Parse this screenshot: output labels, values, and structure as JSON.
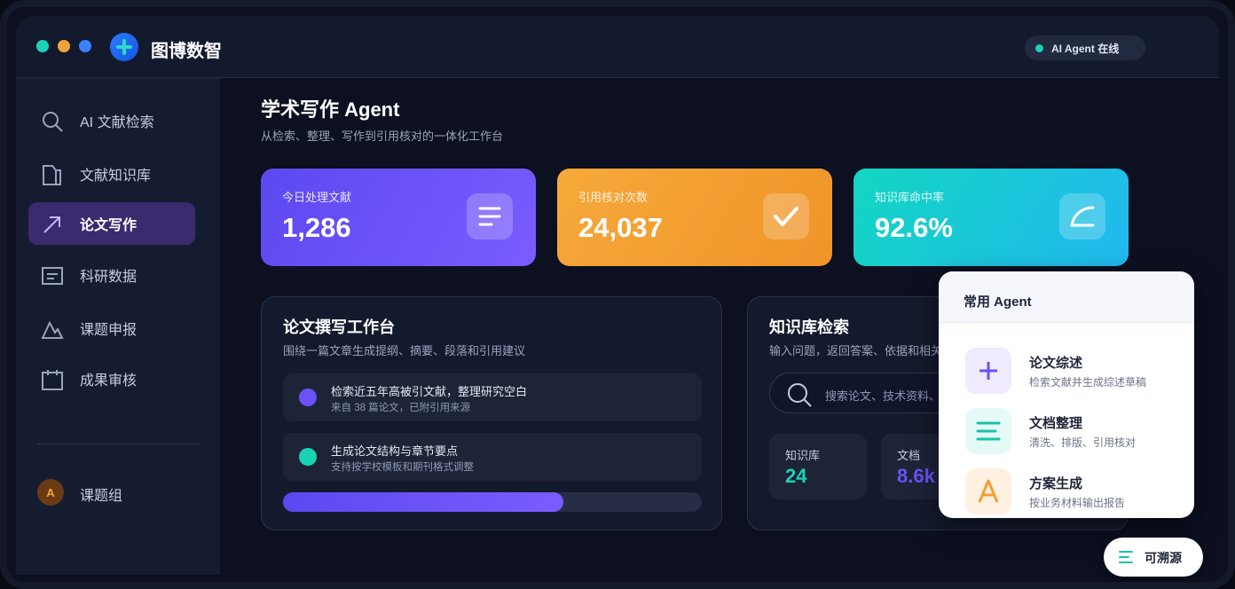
{
  "window": {
    "brand": "图博数智",
    "status": "AI Agent 在线"
  },
  "sidebar": {
    "items": [
      {
        "label": "AI 文献检索",
        "icon": "search-icon"
      },
      {
        "label": "文献知识库",
        "icon": "book-icon"
      },
      {
        "label": "论文写作",
        "icon": "arrow-up-right-icon",
        "active": true
      },
      {
        "label": "科研数据",
        "icon": "data-list-icon"
      },
      {
        "label": "课题申报",
        "icon": "mountain-icon"
      },
      {
        "label": "成果审核",
        "icon": "calendar-icon"
      }
    ],
    "user": {
      "avatar_letter": "A",
      "label": "课题组"
    }
  },
  "main": {
    "title": "学术写作 Agent",
    "subtitle": "从检索、整理、写作到引用核对的一体化工作台"
  },
  "stats": [
    {
      "label": "今日处理文献",
      "value": "1,286",
      "icon": "list-icon",
      "color": "#6a52f6"
    },
    {
      "label": "引用核对次数",
      "value": "24,037",
      "icon": "check-icon",
      "color": "#f39f33"
    },
    {
      "label": "知识库命中率",
      "value": "92.6%",
      "icon": "gauge-icon",
      "color": "#18c9d8"
    }
  ],
  "writing_panel": {
    "title": "论文撰写工作台",
    "subtitle": "围绕一篇文章生成提纲、摘要、段落和引用建议",
    "tasks": [
      {
        "title": "检索近五年高被引文献，整理研究空白",
        "sub": "来自 38 篇论文，已附引用来源",
        "color": "#6a52f6"
      },
      {
        "title": "生成论文结构与章节要点",
        "sub": "支持按学校模板和期刊格式调整",
        "color": "#19d3b4"
      }
    ],
    "progress": 0.67
  },
  "kb_panel": {
    "title": "知识库检索",
    "subtitle": "输入问题，返回答案、依据和相关",
    "search_placeholder": "搜索论文、技术资料、项",
    "tiles": [
      {
        "label": "知识库",
        "value": "24",
        "color": "#19d3b4"
      },
      {
        "label": "文档",
        "value": "8.6k",
        "color": "#6a52f6"
      }
    ]
  },
  "popup": {
    "title": "常用 Agent",
    "agents": [
      {
        "title": "论文综述",
        "sub": "检索文献并生成综述草稿",
        "icon": "plus-icon"
      },
      {
        "title": "文档整理",
        "sub": "清洗、排版、引用核对",
        "icon": "lines-icon"
      },
      {
        "title": "方案生成",
        "sub": "按业务材料输出报告",
        "icon": "letter-a-icon"
      }
    ]
  },
  "trace_button": {
    "label": "可溯源"
  }
}
